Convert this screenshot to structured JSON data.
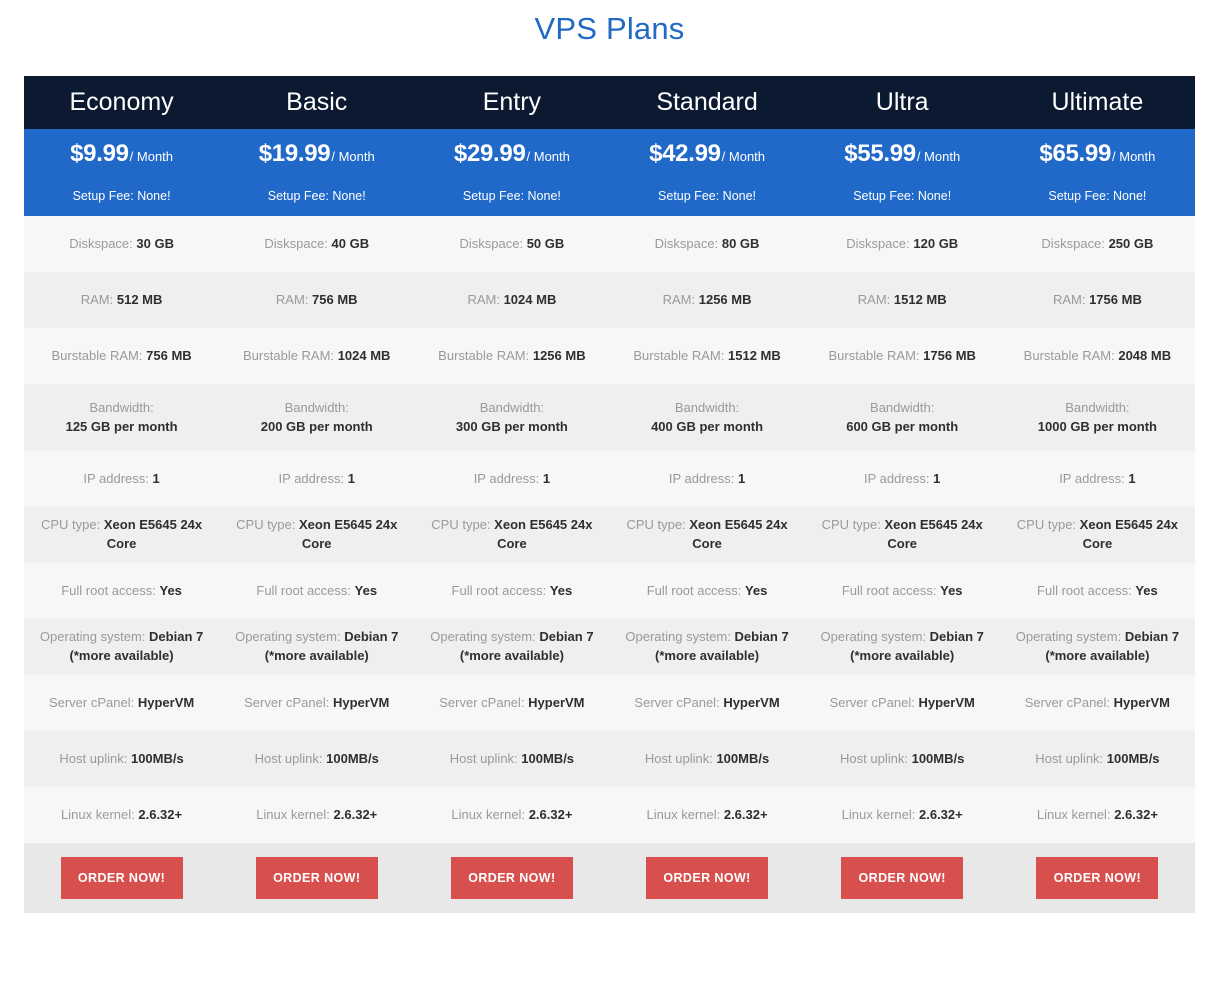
{
  "title": "VPS Plans",
  "accent_color": "#2269c4",
  "header_bg": "#0b1a30",
  "price_bg": "#2069c9",
  "order_button_color": "#d8504e",
  "columns": [
    {
      "name": "Economy",
      "price_amount": "$9.99",
      "price_period": "/ Month",
      "setup_fee": "Setup Fee: None!",
      "order_label": "ORDER NOW!"
    },
    {
      "name": "Basic",
      "price_amount": "$19.99",
      "price_period": "/ Month",
      "setup_fee": "Setup Fee: None!",
      "order_label": "ORDER NOW!"
    },
    {
      "name": "Entry",
      "price_amount": "$29.99",
      "price_period": "/ Month",
      "setup_fee": "Setup Fee: None!",
      "order_label": "ORDER NOW!"
    },
    {
      "name": "Standard",
      "price_amount": "$42.99",
      "price_period": "/ Month",
      "setup_fee": "Setup Fee: None!",
      "order_label": "ORDER NOW!"
    },
    {
      "name": "Ultra",
      "price_amount": "$55.99",
      "price_period": "/ Month",
      "setup_fee": "Setup Fee: None!",
      "order_label": "ORDER NOW!"
    },
    {
      "name": "Ultimate",
      "price_amount": "$65.99",
      "price_period": "/ Month",
      "setup_fee": "Setup Fee: None!",
      "order_label": "ORDER NOW!"
    }
  ],
  "features": [
    {
      "label": "Diskspace:",
      "wrap": false,
      "values": [
        "30 GB",
        "40 GB",
        "50 GB",
        "80 GB",
        "120 GB",
        "250 GB"
      ]
    },
    {
      "label": "RAM:",
      "wrap": false,
      "values": [
        "512 MB",
        "756 MB",
        "1024 MB",
        "1256 MB",
        "1512 MB",
        "1756 MB"
      ]
    },
    {
      "label": "Burstable RAM:",
      "wrap": false,
      "values": [
        "756 MB",
        "1024 MB",
        "1256 MB",
        "1512 MB",
        "1756 MB",
        "2048 MB"
      ]
    },
    {
      "label": "Bandwidth:",
      "wrap": true,
      "values": [
        "125 GB per month",
        "200 GB per month",
        "300 GB per month",
        "400 GB per month",
        "600 GB per month",
        "1000 GB per month"
      ]
    },
    {
      "label": "IP address:",
      "wrap": false,
      "values": [
        "1",
        "1",
        "1",
        "1",
        "1",
        "1"
      ]
    },
    {
      "label": "CPU type:",
      "wrap": false,
      "values": [
        "Xeon E5645 24x Core",
        "Xeon E5645 24x Core",
        "Xeon E5645 24x Core",
        "Xeon E5645 24x Core",
        "Xeon E5645 24x Core",
        "Xeon E5645 24x Core"
      ]
    },
    {
      "label": "Full root access:",
      "wrap": false,
      "values": [
        "Yes",
        "Yes",
        "Yes",
        "Yes",
        "Yes",
        "Yes"
      ]
    },
    {
      "label": "Operating system:",
      "wrap": false,
      "values": [
        "Debian 7 (*more available)",
        "Debian 7 (*more available)",
        "Debian 7 (*more available)",
        "Debian 7 (*more available)",
        "Debian 7 (*more available)",
        "Debian 7 (*more available)"
      ]
    },
    {
      "label": "Server cPanel:",
      "wrap": false,
      "values": [
        "HyperVM",
        "HyperVM",
        "HyperVM",
        "HyperVM",
        "HyperVM",
        "HyperVM"
      ]
    },
    {
      "label": "Host uplink:",
      "wrap": false,
      "values": [
        "100MB/s",
        "100MB/s",
        "100MB/s",
        "100MB/s",
        "100MB/s",
        "100MB/s"
      ]
    },
    {
      "label": "Linux kernel:",
      "wrap": false,
      "values": [
        "2.6.32+",
        "2.6.32+",
        "2.6.32+",
        "2.6.32+",
        "2.6.32+",
        "2.6.32+"
      ]
    }
  ]
}
